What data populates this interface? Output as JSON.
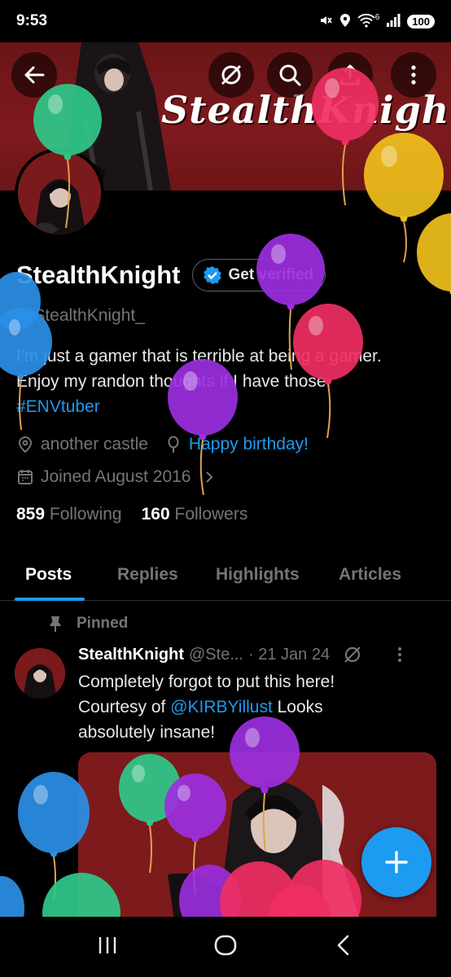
{
  "status_bar": {
    "time": "9:53",
    "network": "6",
    "battery": "100"
  },
  "banner": {
    "title": "StealthKnight"
  },
  "profile": {
    "display_name": "StealthKnight",
    "verify_label": "Get verified",
    "handle": "@StealthKnight_",
    "bio_line1": "I'm just a gamer that is terrible at being a gamer.",
    "bio_line2": "Enjoy my randon thoughts if I have those.",
    "bio_hashtag": "#ENVtuber",
    "location": "another castle",
    "birthday": "Happy birthday!",
    "joined": "Joined August 2016",
    "following_count": "859",
    "following_label": "Following",
    "followers_count": "160",
    "followers_label": "Followers"
  },
  "tabs": [
    "Posts",
    "Replies",
    "Highlights",
    "Articles"
  ],
  "post": {
    "pinned_label": "Pinned",
    "author_name": "StealthKnight",
    "author_handle": "@Ste...",
    "date": "· 21 Jan 24",
    "text_line1": "Completely forgot to put this here!",
    "text_line2_prefix": "Courtesy of ",
    "mention": "@KIRBYillust",
    "text_line2_suffix": " Looks",
    "text_line3": "absolutely insane!"
  },
  "icons": [
    "back-arrow-icon",
    "grok-icon",
    "search-icon",
    "share-icon",
    "more-icon",
    "verified-badge-icon",
    "location-icon",
    "balloon-icon",
    "calendar-icon",
    "pin-icon",
    "plus-icon",
    "recents-icon",
    "home-icon",
    "back-icon"
  ],
  "colors": {
    "accent": "#1d9bf0",
    "banner": "#7e1a1d",
    "muted": "#71767b"
  }
}
